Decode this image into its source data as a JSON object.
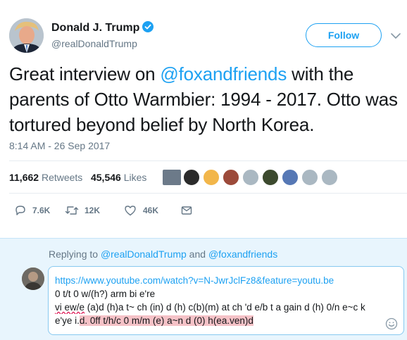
{
  "tweet": {
    "author_name": "Donald J. Trump",
    "author_handle": "@realDonaldTrump",
    "follow_label": "Follow",
    "text_prefix": "Great interview on ",
    "text_mention": "@foxandfriends",
    "text_suffix": " with the parents of Otto Warmbier: 1994 - 2017. Otto was tortured beyond belief by North Korea.",
    "timestamp": "8:14 AM - 26 Sep 2017",
    "retweets_count": "11,662",
    "retweets_label": "Retweets",
    "likes_count": "45,546",
    "likes_label": "Likes"
  },
  "actions": {
    "replies": "7.6K",
    "retweets": "12K",
    "likes": "46K"
  },
  "reply": {
    "replying_prefix": "Replying to ",
    "replying_user1": "@realDonaldTrump",
    "replying_and": " and ",
    "replying_user2": "@foxandfriends",
    "url": "https://www.youtube.com/watch?v=N-JwrJclFz8&feature=youtu.be",
    "line2": "0 t/t 0 w/(h?) arm bi e're",
    "line3_misspelled": "vi ew/e",
    "line3_rest": " (a)d (h)a t~ ch (in) d (h) c(b)(m) at ch 'd e/b t a gain d (h) 0/n e~c k",
    "line4_plain": "e'ye i.",
    "line4_highlight": "d. 0ff t/h/c 0 m/m (e) a~n d (0) h(ea.ven)d"
  },
  "colors": {
    "accent": "#1da1f2",
    "verified": "#1da1f2",
    "reply_bg": "#e8f5fd",
    "highlight": "#f5c2c7"
  }
}
